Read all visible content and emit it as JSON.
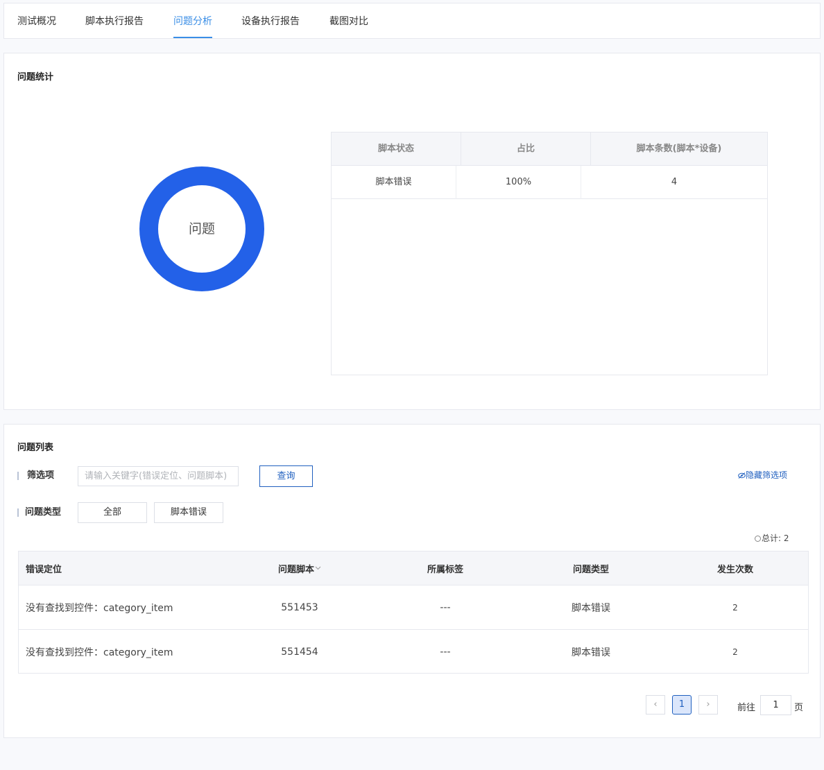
{
  "tabs": [
    {
      "label": "测试概况"
    },
    {
      "label": "脚本执行报告"
    },
    {
      "label": "问题分析"
    },
    {
      "label": "设备执行报告"
    },
    {
      "label": "截图对比"
    }
  ],
  "active_tab": "问题分析",
  "stats": {
    "title": "问题统计",
    "donut_label": "问题",
    "donut_color": "#2361e8",
    "chart_data": {
      "type": "pie",
      "categories": [
        "脚本错误"
      ],
      "values": [
        100
      ]
    },
    "table": {
      "headers": [
        "脚本状态",
        "占比",
        "脚本条数(脚本*设备)"
      ],
      "rows": [
        {
          "status": "脚本错误",
          "ratio": "100%",
          "count": "4"
        }
      ]
    }
  },
  "issues": {
    "title": "问题列表",
    "filter_label": "筛选项",
    "search_placeholder": "请输入关键字(错误定位、问题脚本)",
    "query_label": "查询",
    "hide_filter_label": "隐藏筛选项",
    "type_label": "问题类型",
    "type_options": [
      "全部",
      "脚本错误"
    ],
    "total_label": "总计:",
    "total_value": "2",
    "headers": [
      "错误定位",
      "问题脚本",
      "所属标签",
      "问题类型",
      "发生次数"
    ],
    "rows": [
      {
        "location": "没有查找到控件：category_item",
        "script": "551453",
        "tag": "---",
        "type": "脚本错误",
        "count": "2"
      },
      {
        "location": "没有查找到控件：category_item",
        "script": "551454",
        "tag": "---",
        "type": "脚本错误",
        "count": "2"
      }
    ]
  },
  "pagination": {
    "current_page": "1",
    "goto_label": "前往",
    "goto_value": "1",
    "page_suffix": "页",
    "prev_glyph": "‹",
    "next_glyph": "›"
  }
}
